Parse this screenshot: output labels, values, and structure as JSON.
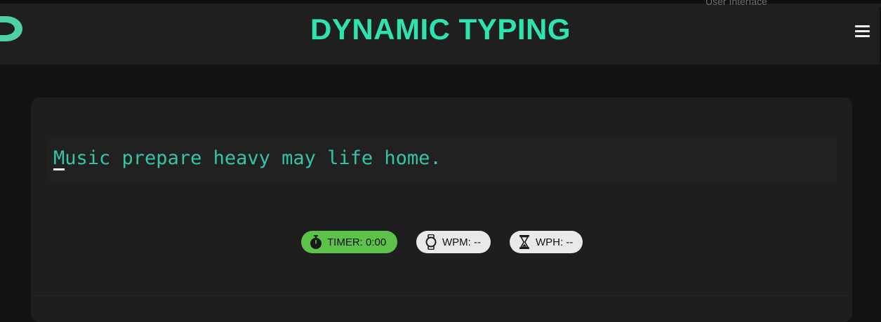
{
  "header": {
    "title": "DYNAMIC TYPING",
    "top_edge_text": "User Interface",
    "logo_icon": "d-letter-logo-icon",
    "menu_icon": "hamburger-menu-icon",
    "accent_color": "#2ee3b0"
  },
  "typing": {
    "first_char": "M",
    "rest": "usic prepare heavy may life home.",
    "text_color": "#35c4aa"
  },
  "stats": {
    "timer_label": "TIMER: 0:00",
    "timer_icon": "stopwatch-icon",
    "timer_color": "#5cc24a",
    "wpm_label": "WPM: --",
    "wpm_icon": "watch-icon",
    "wph_label": "WPH: --",
    "wph_icon": "hourglass-icon"
  }
}
